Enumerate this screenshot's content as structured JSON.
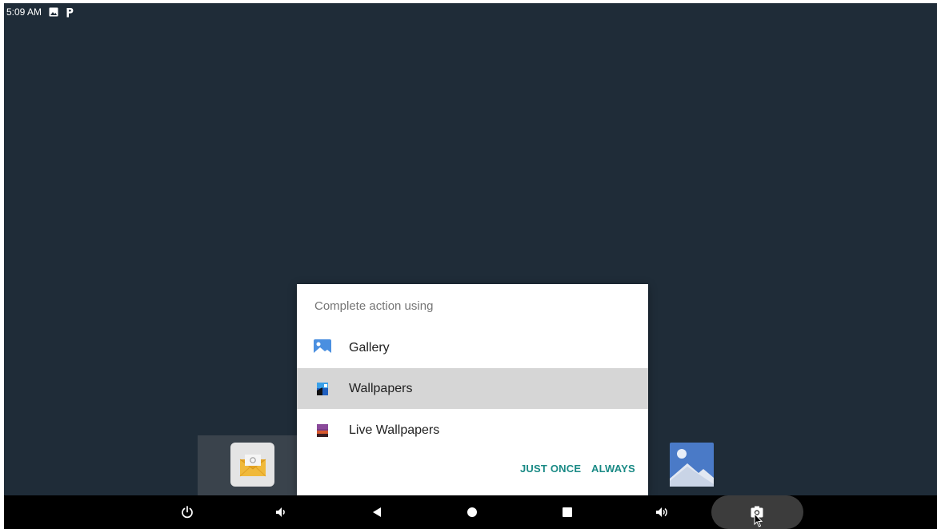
{
  "status_bar": {
    "time": "5:09 AM",
    "icons": [
      "image-notification-icon",
      "parking-p-icon"
    ]
  },
  "dock": {
    "apps": [
      "email-app-icon",
      "gallery-app-icon"
    ]
  },
  "dialog": {
    "title": "Complete action using",
    "options": [
      {
        "label": "Gallery",
        "icon": "gallery-icon",
        "selected": false
      },
      {
        "label": "Wallpapers",
        "icon": "wallpapers-icon",
        "selected": true
      },
      {
        "label": "Live Wallpapers",
        "icon": "live-wallpapers-icon",
        "selected": false
      }
    ],
    "buttons": {
      "just_once": "JUST ONCE",
      "always": "ALWAYS"
    }
  },
  "nav_bar": {
    "buttons": [
      "power-icon",
      "volume-down-icon",
      "back-icon",
      "home-icon",
      "recents-icon",
      "volume-up-icon",
      "screenshot-icon"
    ]
  },
  "colors": {
    "background": "#1f2c38",
    "accent": "#1a8a85",
    "selected_row": "#d6d6d6",
    "nav_bar": "#000000"
  }
}
